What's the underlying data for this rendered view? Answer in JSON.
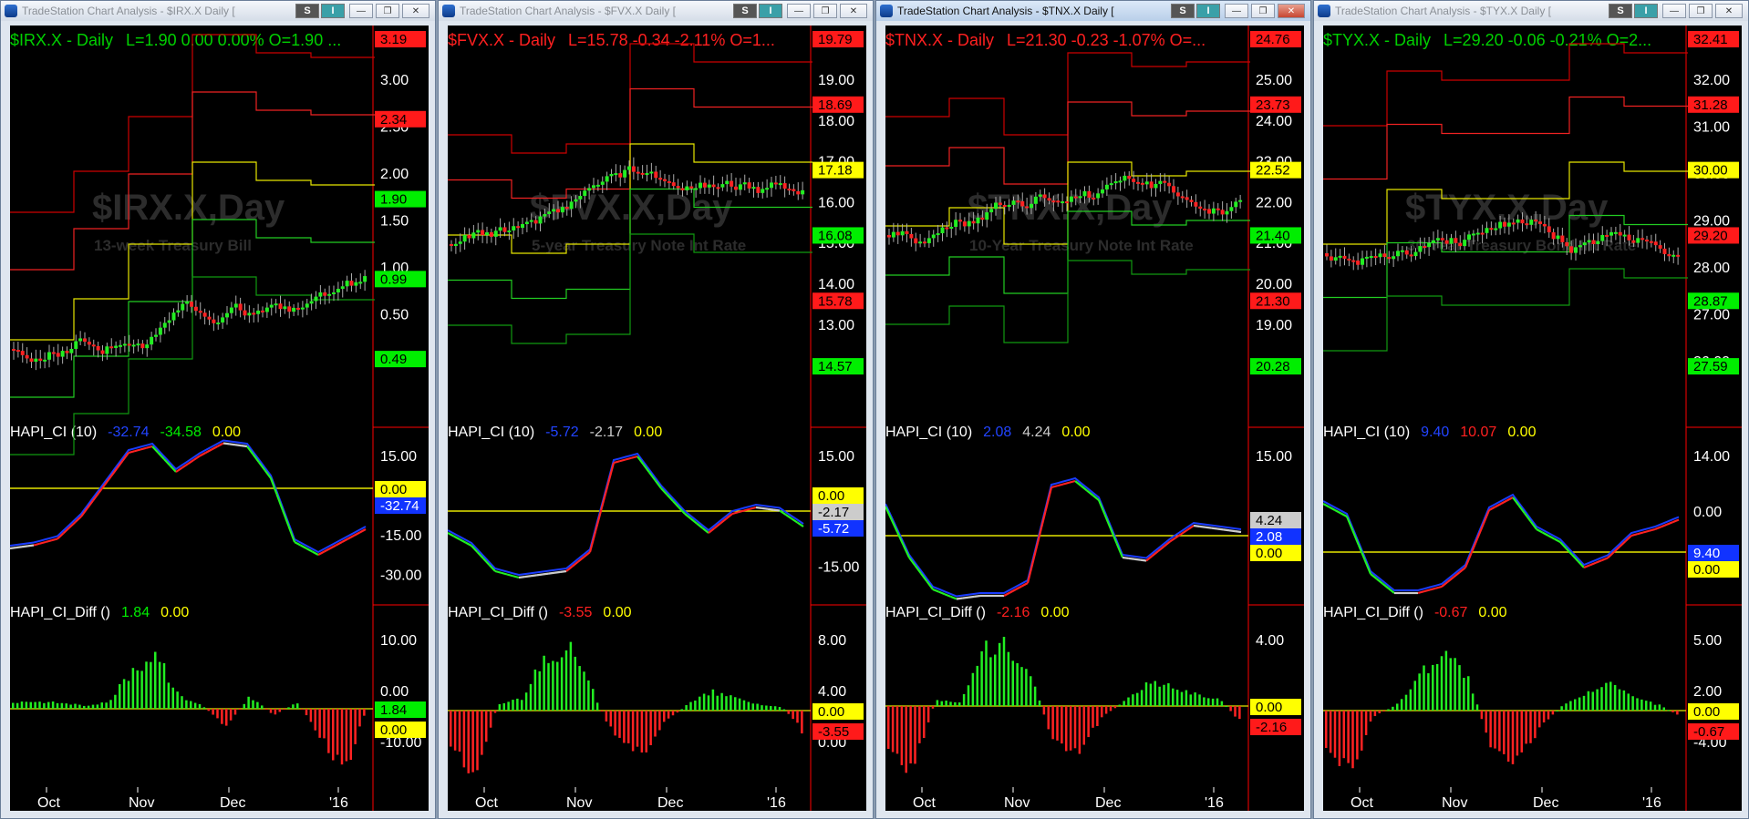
{
  "windows": [
    {
      "title": "TradeStation Chart Analysis - $IRX.X Daily [",
      "active": false,
      "header": {
        "symbol": "$IRX.X - Daily",
        "stats": "L=1.90  0.00  0.00%  O=1.90  ...",
        "color": "#00d000"
      },
      "watermark": {
        "symbol": "$IRX.X,Day",
        "description": "13-week Treasury Bill"
      },
      "price_axis": [
        "3.00",
        "2.50",
        "2.00",
        "1.50",
        "1.00",
        "0.50",
        "0.00"
      ],
      "price_tags": [
        {
          "value": "3.19",
          "color": "#ff1a1a"
        },
        {
          "value": "2.34",
          "color": "#ff1a1a"
        },
        {
          "value": "1.90",
          "color": "#00ee00"
        },
        {
          "value": "0.99",
          "color": "#00ee00"
        },
        {
          "value": "0.49",
          "color": "#00ee00"
        }
      ],
      "ci_panel": {
        "label": "HAPI_CI (10)",
        "v1": "-32.74",
        "v2": "-34.58",
        "v3": "0.00",
        "v1color": "#2244ff",
        "v2color": "#00ee00"
      },
      "ci_axis": [
        "15.00",
        "0.00",
        "-15.00",
        "-30.00"
      ],
      "ci_tags": [
        {
          "value": "0.00",
          "color": "#ffff00"
        },
        {
          "value": "-32.74",
          "color": "#1133ff"
        }
      ],
      "diff_panel": {
        "label": "HAPI_CI_Diff ()",
        "v1": "1.84",
        "v2": "0.00",
        "v1color": "#00ee00"
      },
      "diff_axis": [
        "10.00",
        "0.00",
        "-10.00"
      ],
      "diff_tags": [
        {
          "value": "1.84",
          "color": "#00ee00"
        },
        {
          "value": "0.00",
          "color": "#ffff00"
        }
      ],
      "months": [
        "Oct",
        "Nov",
        "Dec",
        "'16"
      ]
    },
    {
      "title": "TradeStation Chart Analysis - $FVX.X Daily [",
      "active": false,
      "header": {
        "symbol": "$FVX.X - Daily",
        "stats": "L=15.78  -0.34  -2.11%  O=1...",
        "color": "#ff2020"
      },
      "watermark": {
        "symbol": "$FVX.X,Day",
        "description": "5-year Treasury Note Int Rate"
      },
      "price_axis": [
        "19.00",
        "18.00",
        "17.00",
        "16.00",
        "15.00",
        "14.00",
        "13.00",
        "12.00"
      ],
      "price_tags": [
        {
          "value": "19.79",
          "color": "#ff1a1a"
        },
        {
          "value": "18.69",
          "color": "#ff1a1a"
        },
        {
          "value": "17.18",
          "color": "#ffff00"
        },
        {
          "value": "16.08",
          "color": "#00ee00"
        },
        {
          "value": "15.78",
          "color": "#ff1a1a"
        },
        {
          "value": "14.57",
          "color": "#00ee00"
        }
      ],
      "ci_panel": {
        "label": "HAPI_CI (10)",
        "v1": "-5.72",
        "v2": "-2.17",
        "v3": "0.00",
        "v1color": "#2244ff",
        "v2color": "#cccccc"
      },
      "ci_axis": [
        "15.00",
        "5.00",
        "-15.00"
      ],
      "ci_tags": [
        {
          "value": "0.00",
          "color": "#ffff00"
        },
        {
          "value": "-2.17",
          "color": "#cccccc"
        },
        {
          "value": "-5.72",
          "color": "#1133ff"
        }
      ],
      "diff_panel": {
        "label": "HAPI_CI_Diff ()",
        "v1": "-3.55",
        "v2": "0.00",
        "v1color": "#ff2020"
      },
      "diff_axis": [
        "8.00",
        "4.00",
        "0.00"
      ],
      "diff_tags": [
        {
          "value": "0.00",
          "color": "#ffff00"
        },
        {
          "value": "-3.55",
          "color": "#ff1a1a"
        }
      ],
      "months": [
        "Oct",
        "Nov",
        "Dec",
        "'16"
      ]
    },
    {
      "title": "TradeStation Chart Analysis - $TNX.X Daily [",
      "active": true,
      "header": {
        "symbol": "$TNX.X - Daily",
        "stats": "L=21.30  -0.23  -1.07%  O=...",
        "color": "#ff2020"
      },
      "watermark": {
        "symbol": "$TNX.X,Day",
        "description": "10-Year Treasury Note Int Rate"
      },
      "price_axis": [
        "25.00",
        "24.00",
        "23.00",
        "22.00",
        "21.00",
        "20.00",
        "19.00",
        "18.00"
      ],
      "price_tags": [
        {
          "value": "24.76",
          "color": "#ff1a1a"
        },
        {
          "value": "23.73",
          "color": "#ff1a1a"
        },
        {
          "value": "22.52",
          "color": "#ffff00"
        },
        {
          "value": "21.40",
          "color": "#00ee00"
        },
        {
          "value": "21.30",
          "color": "#ff1a1a"
        },
        {
          "value": "20.28",
          "color": "#00ee00"
        }
      ],
      "ci_panel": {
        "label": "HAPI_CI (10)",
        "v1": "2.08",
        "v2": "4.24",
        "v3": "0.00",
        "v1color": "#2244ff",
        "v2color": "#cccccc"
      },
      "ci_axis": [
        "15.00",
        "-5.00"
      ],
      "ci_tags": [
        {
          "value": "4.24",
          "color": "#cccccc"
        },
        {
          "value": "2.08",
          "color": "#1133ff"
        },
        {
          "value": "0.00",
          "color": "#ffff00"
        }
      ],
      "diff_panel": {
        "label": "HAPI_CI_Diff ()",
        "v1": "-2.16",
        "v2": "0.00",
        "v1color": "#ff2020"
      },
      "diff_axis": [
        "4.00",
        "-4.00"
      ],
      "diff_tags": [
        {
          "value": "0.00",
          "color": "#ffff00"
        },
        {
          "value": "-2.16",
          "color": "#ff1a1a"
        }
      ],
      "months": [
        "Oct",
        "Nov",
        "Dec",
        "'16"
      ]
    },
    {
      "title": "TradeStation Chart Analysis - $TYX.X Daily [",
      "active": false,
      "header": {
        "symbol": "$TYX.X - Daily",
        "stats": "L=29.20  -0.06  -0.21%  O=2...",
        "color": "#00d000"
      },
      "watermark": {
        "symbol": "$TYX.X,Day",
        "description": "30-Year Treasury Bond Int Rate"
      },
      "price_axis": [
        "32.00",
        "31.00",
        "30.00",
        "29.00",
        "28.00",
        "27.00",
        "26.00"
      ],
      "price_tags": [
        {
          "value": "32.41",
          "color": "#ff1a1a"
        },
        {
          "value": "31.28",
          "color": "#ff1a1a"
        },
        {
          "value": "30.00",
          "color": "#ffff00"
        },
        {
          "value": "29.20",
          "color": "#ff1a1a"
        },
        {
          "value": "28.87",
          "color": "#00ee00"
        },
        {
          "value": "27.59",
          "color": "#00ee00"
        }
      ],
      "ci_panel": {
        "label": "HAPI_CI (10)",
        "v1": "9.40",
        "v2": "10.07",
        "v3": "0.00",
        "v1color": "#2244ff",
        "v2color": "#ff2020"
      },
      "ci_axis": [
        "14.00",
        "0.00",
        "-4.00"
      ],
      "ci_tags": [
        {
          "value": "9.40",
          "color": "#1133ff"
        },
        {
          "value": "0.00",
          "color": "#ffff00"
        }
      ],
      "diff_panel": {
        "label": "HAPI_CI_Diff ()",
        "v1": "-0.67",
        "v2": "0.00",
        "v1color": "#ff2020"
      },
      "diff_axis": [
        "5.00",
        "2.00",
        "-4.00"
      ],
      "diff_tags": [
        {
          "value": "0.00",
          "color": "#ffff00"
        },
        {
          "value": "-0.67",
          "color": "#ff1a1a"
        }
      ],
      "months": [
        "Oct",
        "Nov",
        "Dec",
        "'16"
      ]
    }
  ],
  "toolbar": {
    "s_label": "S",
    "i_label": "I"
  },
  "window_controls": {
    "minimize": "—",
    "restore": "❐",
    "close": "✕"
  }
}
